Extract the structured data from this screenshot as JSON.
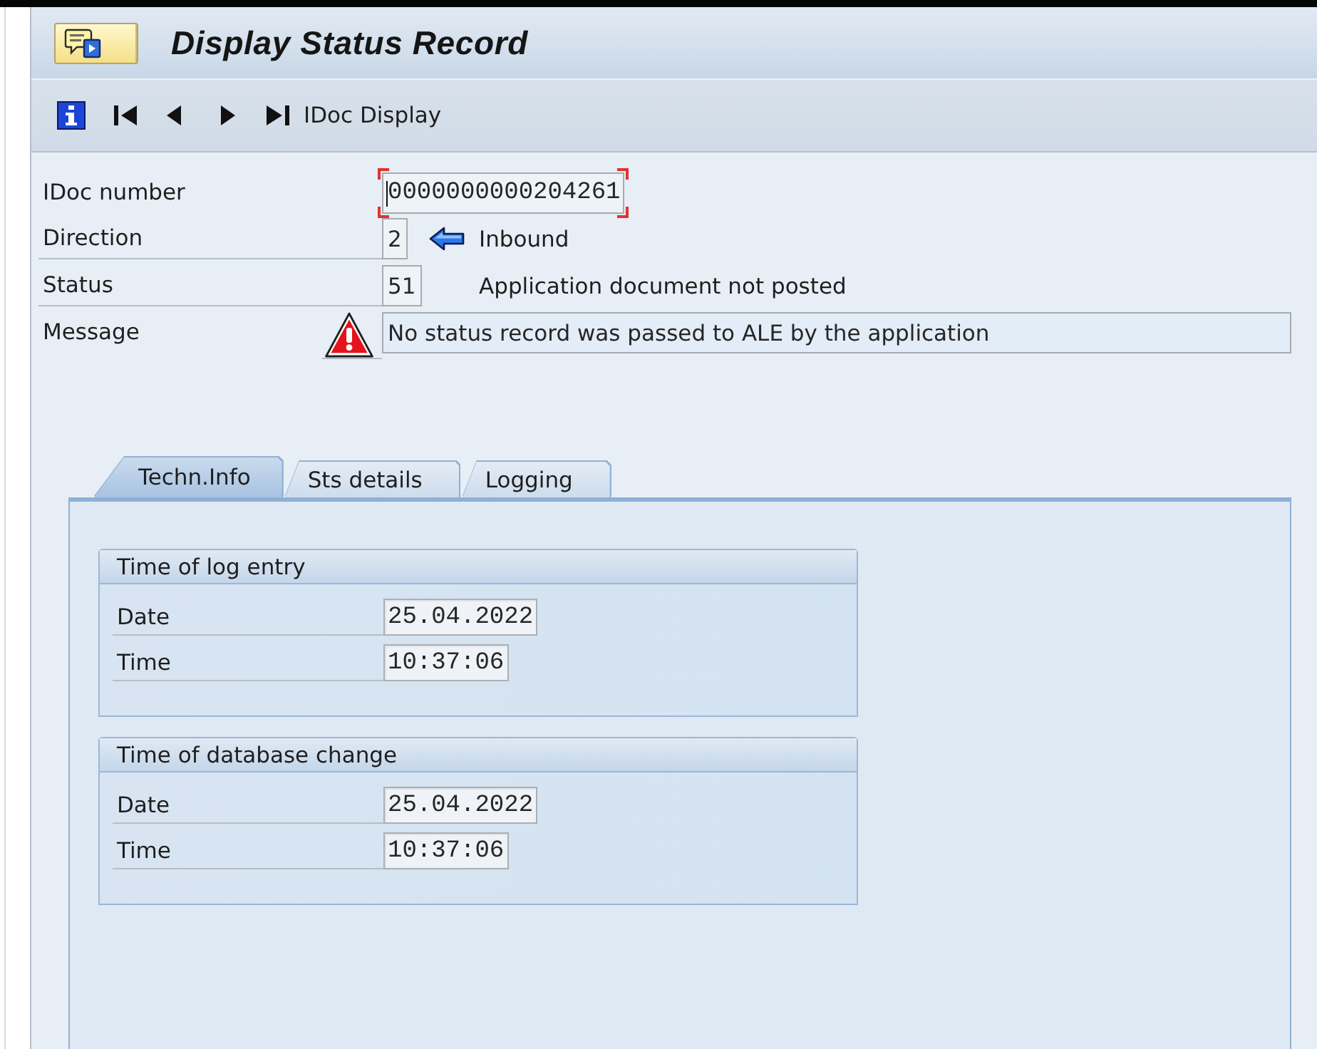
{
  "window": {
    "title": "Display Status Record"
  },
  "toolbar": {
    "label": "IDoc Display"
  },
  "header_fields": [
    {
      "kind": "number",
      "label": "IDoc number",
      "value": "0000000000204261",
      "focused": true
    },
    {
      "kind": "direction",
      "label": "Direction",
      "value": "2",
      "text": "Inbound",
      "focused": false
    },
    {
      "kind": "status",
      "label": "Status",
      "value": "51",
      "text": "Application document not posted",
      "focused": false
    },
    {
      "kind": "message",
      "label": "Message",
      "value": "No status record was passed to ALE by the application",
      "focused": false
    }
  ],
  "tabs": [
    {
      "label": "Techn.Info",
      "selected": true
    },
    {
      "label": "Sts details",
      "selected": false
    },
    {
      "label": "Logging",
      "selected": false
    }
  ],
  "groups": [
    {
      "title": "Time of log entry",
      "fields": [
        {
          "label": "Date",
          "value": "25.04.2022"
        },
        {
          "label": "Time",
          "value": "10:37:06"
        }
      ]
    },
    {
      "title": "Time of database change",
      "fields": [
        {
          "label": "Date",
          "value": "25.04.2022"
        },
        {
          "label": "Time",
          "value": "10:37:06"
        }
      ]
    }
  ]
}
